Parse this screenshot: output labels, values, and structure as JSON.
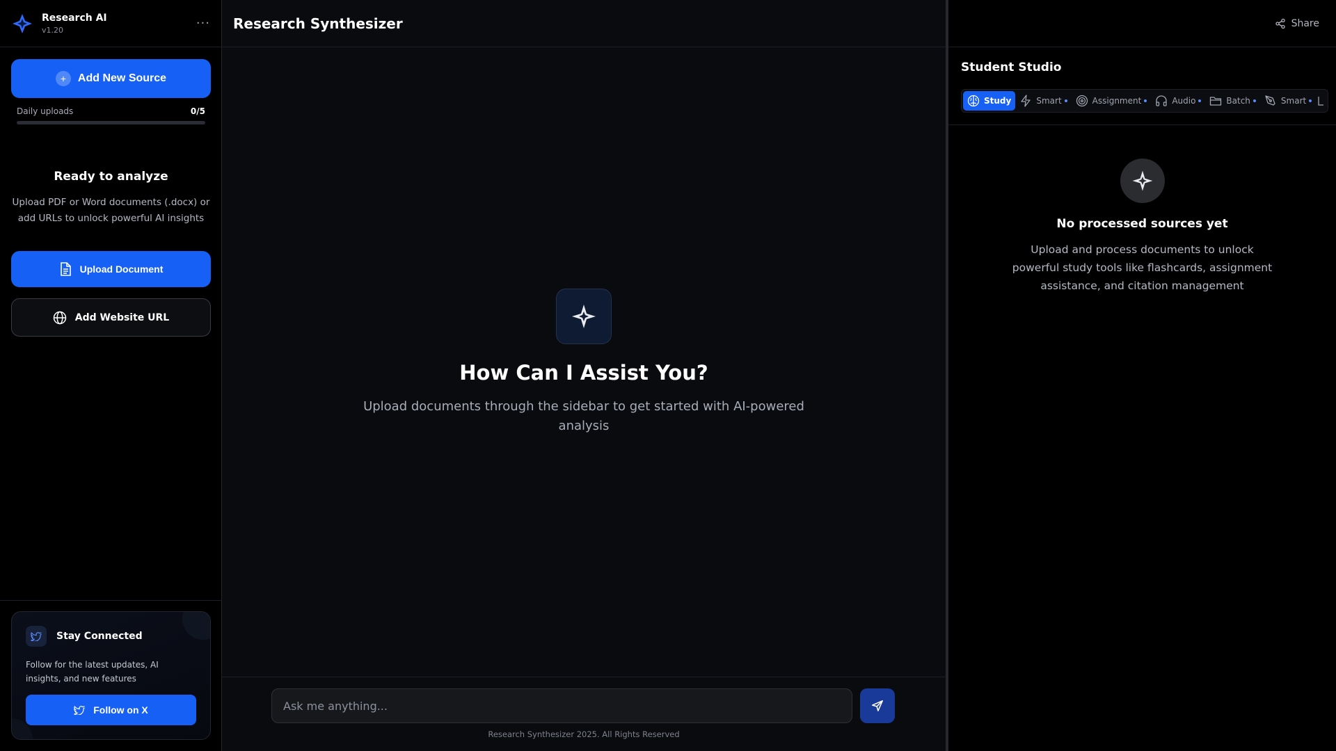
{
  "brand": {
    "name": "Research AI",
    "version": "v1.20"
  },
  "sidebar": {
    "add_source_label": "Add New Source",
    "uploads": {
      "label": "Daily uploads",
      "count": "0/5",
      "used": 0,
      "limit": 5
    },
    "ready": {
      "title": "Ready to analyze",
      "description": "Upload PDF or Word documents (.docx) or add URLs to unlock powerful AI insights"
    },
    "upload_document_label": "Upload Document",
    "add_url_label": "Add Website URL",
    "connect": {
      "title": "Stay Connected",
      "description": "Follow for the latest updates, AI insights, and new features",
      "button_label": "Follow on X"
    }
  },
  "main": {
    "title": "Research Synthesizer",
    "hero": {
      "title": "How Can I Assist You?",
      "subtitle": "Upload documents through the sidebar to get started with AI-powered analysis"
    },
    "chat": {
      "placeholder": "Ask me anything..."
    },
    "footer": "Research Synthesizer 2025. All Rights Reserved"
  },
  "studio": {
    "share_label": "Share",
    "title": "Student Studio",
    "tabs": [
      {
        "label": "Study",
        "icon": "brain-icon",
        "active": true
      },
      {
        "label": "Smart",
        "icon": "lightning-icon",
        "dot": true
      },
      {
        "label": "Assignment",
        "icon": "target-icon",
        "dot": true
      },
      {
        "label": "Audio",
        "icon": "headphones-icon",
        "dot": true
      },
      {
        "label": "Batch",
        "icon": "folder-icon",
        "dot": true
      },
      {
        "label": "Smart",
        "icon": "pen-tool-icon",
        "dot": true
      }
    ],
    "empty": {
      "title": "No processed sources yet",
      "description": "Upload and process documents to unlock powerful study tools like flashcards, assignment assistance, and citation management"
    }
  },
  "colors": {
    "accent": "#1660f5",
    "background": "#0a0b0e",
    "sidebar": "#000000"
  }
}
